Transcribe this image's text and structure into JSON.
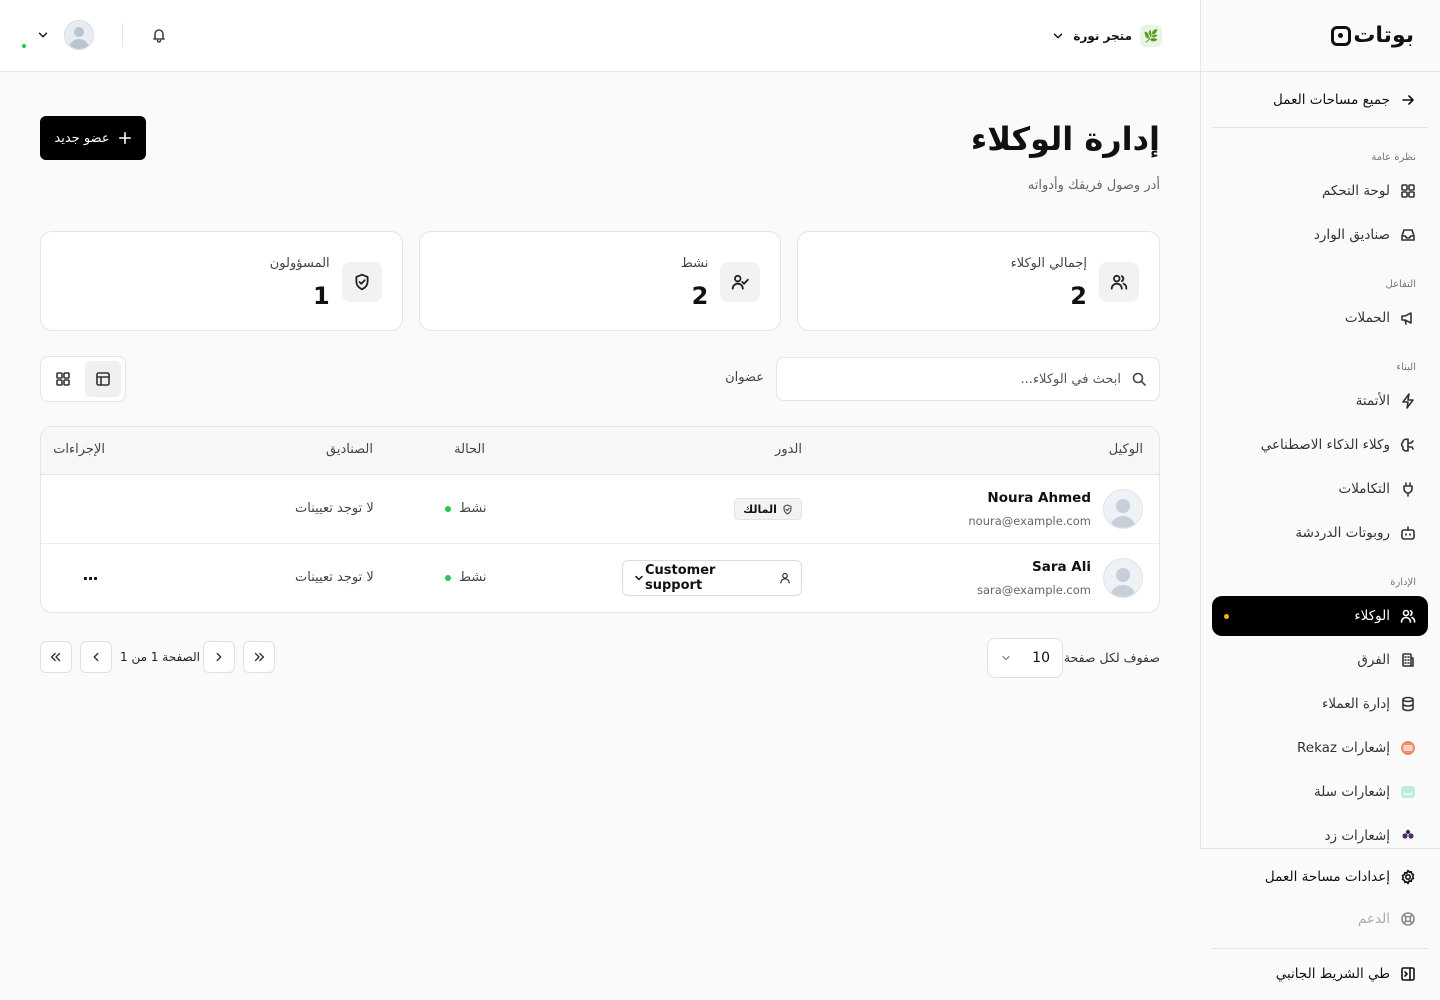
{
  "sidebar": {
    "logo_text": "بوتات",
    "back_label": "جميع مساحات العمل",
    "sections": {
      "overview": "نظرة عامة",
      "engagement": "التفاعل",
      "build": "البناء",
      "admin": "الإدارة"
    },
    "items": {
      "dashboard": "لوحة التحكم",
      "inboxes": "صناديق الوارد",
      "campaigns": "الحملات",
      "automation": "الأتمتة",
      "ai_agents": "وكلاء الذكاء الاصطناعي",
      "integrations": "التكاملات",
      "chatbots": "روبوتات الدردشة",
      "agents": "الوكلاء",
      "teams": "الفرق",
      "customers": "إدارة العملاء",
      "rekaz": "إشعارات Rekaz",
      "salla": "إشعارات سلة",
      "zid": "إشعارات زد"
    },
    "bottom": {
      "settings": "إعدادات مساحة العمل",
      "support": "الدعم",
      "collapse": "طي الشريط الجانبي"
    }
  },
  "topbar": {
    "store_name": "متجر نورة",
    "store_emoji": "🌿"
  },
  "main": {
    "title": "إدارة الوكلاء",
    "subtitle": "أدر وصول فريقك وأدواته",
    "add_button": "عضو جديد",
    "stats": [
      {
        "label": "إجمالي الوكلاء",
        "value": "2"
      },
      {
        "label": "نشط",
        "value": "2"
      },
      {
        "label": "المسؤولون",
        "value": "1"
      }
    ],
    "search_placeholder": "ابحث في الوكلاء...",
    "filter_label": "عضوان",
    "table": {
      "headers": {
        "agent": "الوكيل",
        "role": "الدور",
        "status": "الحالة",
        "inboxes": "الصناديق",
        "actions": "الإجراءات"
      },
      "rows": [
        {
          "name": "Noura Ahmed",
          "email": "noura@example.com",
          "role": "المالك",
          "status": "نشط",
          "inboxes": "لا توجد تعيينات"
        },
        {
          "name": "Sara Ali",
          "email": "sara@example.com",
          "role": "Customer support",
          "status": "نشط",
          "inboxes": "لا توجد تعيينات",
          "actions": "···"
        }
      ]
    },
    "pagination": {
      "rows_per_page_label": "صفوف لكل صفحة",
      "rows_per_page": "10",
      "page_text": "الصفحة 1 من 1"
    }
  }
}
